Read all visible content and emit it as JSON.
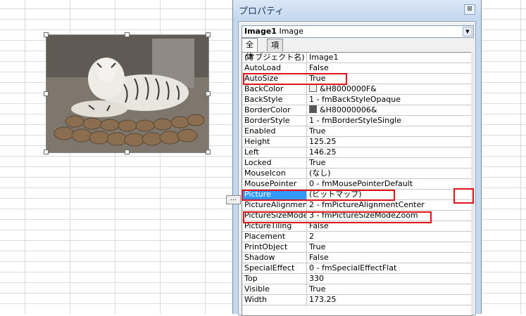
{
  "window": {
    "title": "プロパティ",
    "close_glyph": "⊠"
  },
  "object_selector": {
    "name": "Image1",
    "type": "Image"
  },
  "tabs": [
    "全体",
    "項目別"
  ],
  "properties": [
    {
      "name": "(オブジェクト名)",
      "value": "Image1"
    },
    {
      "name": "AutoLoad",
      "value": "False"
    },
    {
      "name": "AutoSize",
      "value": "True"
    },
    {
      "name": "BackColor",
      "value": "&H8000000F&",
      "swatch": "#f0f0f0"
    },
    {
      "name": "BackStyle",
      "value": "1 - fmBackStyleOpaque"
    },
    {
      "name": "BorderColor",
      "value": "&H80000006&",
      "swatch": "#555555"
    },
    {
      "name": "BorderStyle",
      "value": "1 - fmBorderStyleSingle"
    },
    {
      "name": "Enabled",
      "value": "True"
    },
    {
      "name": "Height",
      "value": "125.25"
    },
    {
      "name": "Left",
      "value": "146.25"
    },
    {
      "name": "Locked",
      "value": "True"
    },
    {
      "name": "MouseIcon",
      "value": "(なし)"
    },
    {
      "name": "MousePointer",
      "value": "0 - fmMousePointerDefault"
    },
    {
      "name": "Picture",
      "value": "(ビットマップ)",
      "selected": true
    },
    {
      "name": "PictureAlignment",
      "value": "2 - fmPictureAlignmentCenter"
    },
    {
      "name": "PictureSizeMode",
      "value": "3 - fmPictureSizeModeZoom"
    },
    {
      "name": "PictureTiling",
      "value": "False"
    },
    {
      "name": "Placement",
      "value": "2"
    },
    {
      "name": "PrintObject",
      "value": "True"
    },
    {
      "name": "Shadow",
      "value": "False"
    },
    {
      "name": "SpecialEffect",
      "value": "0 - fmSpecialEffectFlat"
    },
    {
      "name": "Top",
      "value": "330"
    },
    {
      "name": "Visible",
      "value": "True"
    },
    {
      "name": "Width",
      "value": "173.25"
    }
  ],
  "picture_button_label": "...",
  "colors": {
    "selection": "#3399ff",
    "highlight": "#e0121a",
    "panel": "#c4d8ee"
  }
}
